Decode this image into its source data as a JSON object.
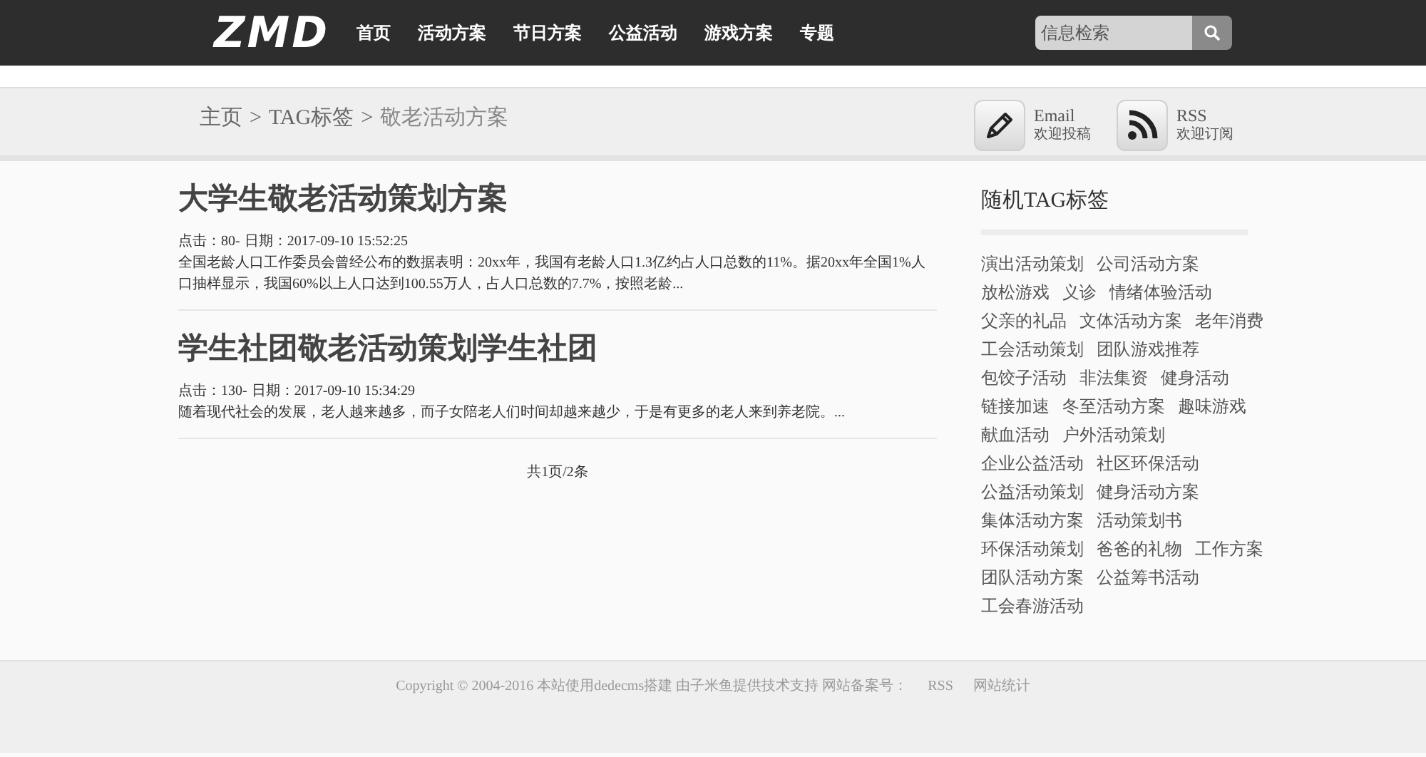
{
  "logo": "ZMD",
  "nav": [
    {
      "label": "首页"
    },
    {
      "label": "活动方案"
    },
    {
      "label": "节日方案"
    },
    {
      "label": "公益活动"
    },
    {
      "label": "游戏方案"
    },
    {
      "label": "专题"
    }
  ],
  "search": {
    "placeholder": "信息检索"
  },
  "breadcrumb": [
    "主页",
    "TAG标签",
    "敬老活动方案"
  ],
  "breadcrumb_separator": ">",
  "links": [
    {
      "kind": "email",
      "title": "Email",
      "subtitle": "欢迎投稿"
    },
    {
      "kind": "rss",
      "title": "RSS",
      "subtitle": "欢迎订阅"
    }
  ],
  "articles": [
    {
      "title": "大学生敬老活动策划方案",
      "clicks_label": "点击：",
      "clicks": "80-",
      "date_label": "日期：",
      "date": "2017-09-10 15:52:25",
      "summary": "全国老龄人口工作委员会曾经公布的数据表明：20xx年，我国有老龄人口1.3亿约占人口总数的11%。据20xx年全国1%人口抽样显示，我国60%以上人口达到100.55万人，占人口总数的7.7%，按照老龄..."
    },
    {
      "title": "学生社团敬老活动策划学生社团",
      "clicks_label": "点击：",
      "clicks": "130-",
      "date_label": "日期：",
      "date": "2017-09-10 15:34:29",
      "summary": "随着现代社会的发展，老人越来越多，而子女陪老人们时间却越来越少，于是有更多的老人来到养老院。..."
    }
  ],
  "pagination": "共1页/2条",
  "sidebar": {
    "title": "随机TAG标签",
    "tag_rows": [
      [
        "演出活动策划",
        "公司活动方案"
      ],
      [
        "放松游戏",
        "义诊",
        "情绪体验活动"
      ],
      [
        "父亲的礼品",
        "文体活动方案",
        "老年消费"
      ],
      [
        "工会活动策划",
        "团队游戏推荐"
      ],
      [
        "包饺子活动",
        "非法集资",
        "健身活动"
      ],
      [
        "链接加速",
        "冬至活动方案",
        "趣味游戏"
      ],
      [
        "献血活动",
        "户外活动策划"
      ],
      [
        "企业公益活动",
        "社区环保活动"
      ],
      [
        "公益活动策划",
        "健身活动方案"
      ],
      [
        "集体活动方案",
        "活动策划书"
      ],
      [
        "环保活动策划",
        "爸爸的礼物",
        "工作方案"
      ],
      [
        "团队活动方案",
        "公益筹书活动"
      ],
      [
        "工会春游活动"
      ]
    ]
  },
  "footer": {
    "text": "Copyright © 2004-2016 本站使用dedecms搭建 由子米鱼提供技术支持 网站备案号：",
    "links": [
      "RSS",
      "网站统计"
    ]
  }
}
